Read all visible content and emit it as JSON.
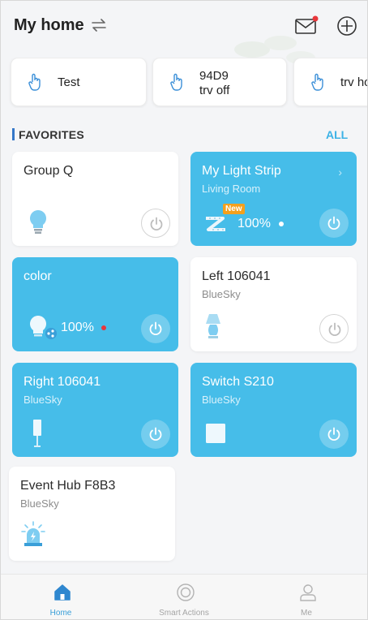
{
  "header": {
    "title": "My home"
  },
  "scenes": [
    {
      "label_line1": "Test",
      "label_line2": ""
    },
    {
      "label_line1": "94D9",
      "label_line2": "trv off"
    },
    {
      "label_line1": "trv ho",
      "label_line2": ""
    }
  ],
  "favorites": {
    "title": "FAVORITES",
    "all_label": "ALL",
    "cards": [
      {
        "name": "Group Q",
        "room": "",
        "level": "",
        "new_badge": ""
      },
      {
        "name": "My Light Strip",
        "room": "Living Room",
        "level": "100%",
        "new_badge": "New"
      },
      {
        "name": "color",
        "room": "",
        "level": "100%",
        "new_badge": ""
      },
      {
        "name": "Left 106041",
        "room": "BlueSky",
        "level": "",
        "new_badge": ""
      },
      {
        "name": "Right 106041",
        "room": "BlueSky",
        "level": "",
        "new_badge": ""
      },
      {
        "name": "Switch S210",
        "room": "BlueSky",
        "level": "",
        "new_badge": ""
      },
      {
        "name": "Event Hub F8B3",
        "room": "BlueSky",
        "level": "",
        "new_badge": ""
      }
    ]
  },
  "tabs": [
    {
      "label": "Home",
      "active": true
    },
    {
      "label": "Smart Actions",
      "active": false
    },
    {
      "label": "Me",
      "active": false
    }
  ],
  "colors": {
    "accent_blue": "#46bde9",
    "link_blue": "#3cb2e6",
    "notification_red": "#e8363b",
    "badge_orange": "#f4a01c"
  }
}
